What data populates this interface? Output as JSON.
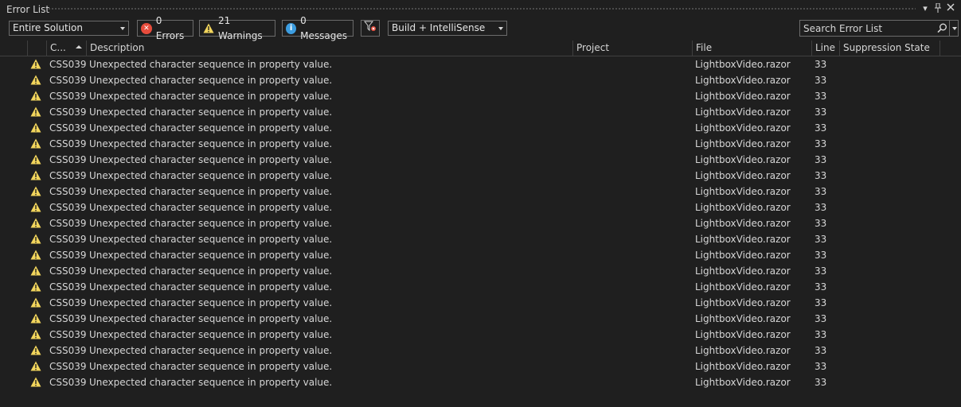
{
  "window": {
    "title": "Error List",
    "title_icons": [
      "dropdown-icon",
      "pin-icon",
      "close-icon"
    ]
  },
  "toolbar": {
    "scope_combo": "Entire Solution",
    "errors_label": "0 Errors",
    "warnings_label": "21 Warnings",
    "messages_label": "0 Messages",
    "source_combo": "Build + IntelliSense",
    "search_placeholder": "Search Error List"
  },
  "columns": {
    "code": "C...",
    "description": "Description",
    "project": "Project",
    "file": "File",
    "line": "Line",
    "suppression": "Suppression State"
  },
  "rows": [
    {
      "code": "CSS039",
      "description": "Unexpected character sequence in property value.",
      "project": "",
      "file": "LightboxVideo.razor",
      "line": "33",
      "suppression": ""
    },
    {
      "code": "CSS039",
      "description": "Unexpected character sequence in property value.",
      "project": "",
      "file": "LightboxVideo.razor",
      "line": "33",
      "suppression": ""
    },
    {
      "code": "CSS039",
      "description": "Unexpected character sequence in property value.",
      "project": "",
      "file": "LightboxVideo.razor",
      "line": "33",
      "suppression": ""
    },
    {
      "code": "CSS039",
      "description": "Unexpected character sequence in property value.",
      "project": "",
      "file": "LightboxVideo.razor",
      "line": "33",
      "suppression": ""
    },
    {
      "code": "CSS039",
      "description": "Unexpected character sequence in property value.",
      "project": "",
      "file": "LightboxVideo.razor",
      "line": "33",
      "suppression": ""
    },
    {
      "code": "CSS039",
      "description": "Unexpected character sequence in property value.",
      "project": "",
      "file": "LightboxVideo.razor",
      "line": "33",
      "suppression": ""
    },
    {
      "code": "CSS039",
      "description": "Unexpected character sequence in property value.",
      "project": "",
      "file": "LightboxVideo.razor",
      "line": "33",
      "suppression": ""
    },
    {
      "code": "CSS039",
      "description": "Unexpected character sequence in property value.",
      "project": "",
      "file": "LightboxVideo.razor",
      "line": "33",
      "suppression": ""
    },
    {
      "code": "CSS039",
      "description": "Unexpected character sequence in property value.",
      "project": "",
      "file": "LightboxVideo.razor",
      "line": "33",
      "suppression": ""
    },
    {
      "code": "CSS039",
      "description": "Unexpected character sequence in property value.",
      "project": "",
      "file": "LightboxVideo.razor",
      "line": "33",
      "suppression": ""
    },
    {
      "code": "CSS039",
      "description": "Unexpected character sequence in property value.",
      "project": "",
      "file": "LightboxVideo.razor",
      "line": "33",
      "suppression": ""
    },
    {
      "code": "CSS039",
      "description": "Unexpected character sequence in property value.",
      "project": "",
      "file": "LightboxVideo.razor",
      "line": "33",
      "suppression": ""
    },
    {
      "code": "CSS039",
      "description": "Unexpected character sequence in property value.",
      "project": "",
      "file": "LightboxVideo.razor",
      "line": "33",
      "suppression": ""
    },
    {
      "code": "CSS039",
      "description": "Unexpected character sequence in property value.",
      "project": "",
      "file": "LightboxVideo.razor",
      "line": "33",
      "suppression": ""
    },
    {
      "code": "CSS039",
      "description": "Unexpected character sequence in property value.",
      "project": "",
      "file": "LightboxVideo.razor",
      "line": "33",
      "suppression": ""
    },
    {
      "code": "CSS039",
      "description": "Unexpected character sequence in property value.",
      "project": "",
      "file": "LightboxVideo.razor",
      "line": "33",
      "suppression": ""
    },
    {
      "code": "CSS039",
      "description": "Unexpected character sequence in property value.",
      "project": "",
      "file": "LightboxVideo.razor",
      "line": "33",
      "suppression": ""
    },
    {
      "code": "CSS039",
      "description": "Unexpected character sequence in property value.",
      "project": "",
      "file": "LightboxVideo.razor",
      "line": "33",
      "suppression": ""
    },
    {
      "code": "CSS039",
      "description": "Unexpected character sequence in property value.",
      "project": "",
      "file": "LightboxVideo.razor",
      "line": "33",
      "suppression": ""
    },
    {
      "code": "CSS039",
      "description": "Unexpected character sequence in property value.",
      "project": "",
      "file": "LightboxVideo.razor",
      "line": "33",
      "suppression": ""
    },
    {
      "code": "CSS039",
      "description": "Unexpected character sequence in property value.",
      "project": "",
      "file": "LightboxVideo.razor",
      "line": "33",
      "suppression": ""
    }
  ],
  "colors": {
    "background": "#1f1f1f",
    "text": "#d6d6d6",
    "error": "#e74c3c",
    "warning": "#f2d55c",
    "info": "#3c9de0"
  }
}
